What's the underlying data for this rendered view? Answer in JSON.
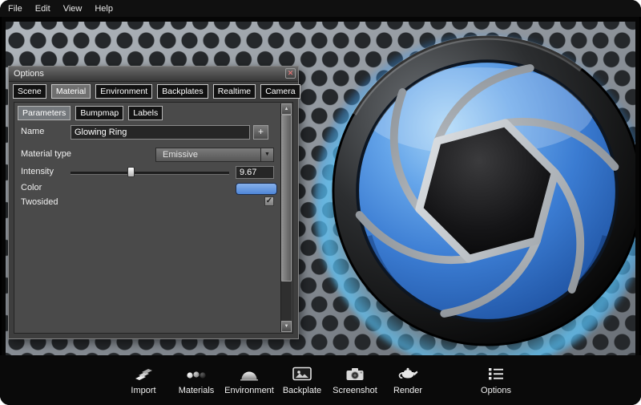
{
  "menu": {
    "items": [
      {
        "label": "File"
      },
      {
        "label": "Edit"
      },
      {
        "label": "View"
      },
      {
        "label": "Help"
      }
    ]
  },
  "options_panel": {
    "title": "Options",
    "close_glyph": "✕",
    "tabs": [
      {
        "label": "Scene",
        "selected": false
      },
      {
        "label": "Material",
        "selected": true
      },
      {
        "label": "Environment",
        "selected": false
      },
      {
        "label": "Backplates",
        "selected": false
      },
      {
        "label": "Realtime",
        "selected": false
      },
      {
        "label": "Camera",
        "selected": false
      }
    ],
    "subtabs": [
      {
        "label": "Parameters",
        "selected": true
      },
      {
        "label": "Bumpmap",
        "selected": false
      },
      {
        "label": "Labels",
        "selected": false
      }
    ],
    "form": {
      "name_label": "Name",
      "name_value": "Glowing Ring",
      "add_button_label": "+",
      "material_type_label": "Material type",
      "material_type_value": "Emissive",
      "dropdown_arrow_glyph": "▼",
      "intensity_label": "Intensity",
      "intensity_value": "9.67",
      "intensity_slider_percent": 38,
      "color_label": "Color",
      "color_swatch": "#4f86d8",
      "twosided_label": "Twosided",
      "twosided_checked": true
    },
    "scrollbar": {
      "up_glyph": "▲",
      "down_glyph": "▼"
    }
  },
  "toolbar": {
    "items": [
      {
        "label": "Import",
        "icon": "import-icon"
      },
      {
        "label": "Materials",
        "icon": "materials-icon"
      },
      {
        "label": "Environment",
        "icon": "environment-icon"
      },
      {
        "label": "Backplate",
        "icon": "backplate-icon"
      },
      {
        "label": "Screenshot",
        "icon": "screenshot-icon"
      },
      {
        "label": "Render",
        "icon": "render-icon"
      },
      {
        "label": "Options",
        "icon": "options-icon"
      }
    ]
  },
  "colors": {
    "accent_blue": "#4f86d8",
    "glow_cyan": "#46c0ff"
  }
}
